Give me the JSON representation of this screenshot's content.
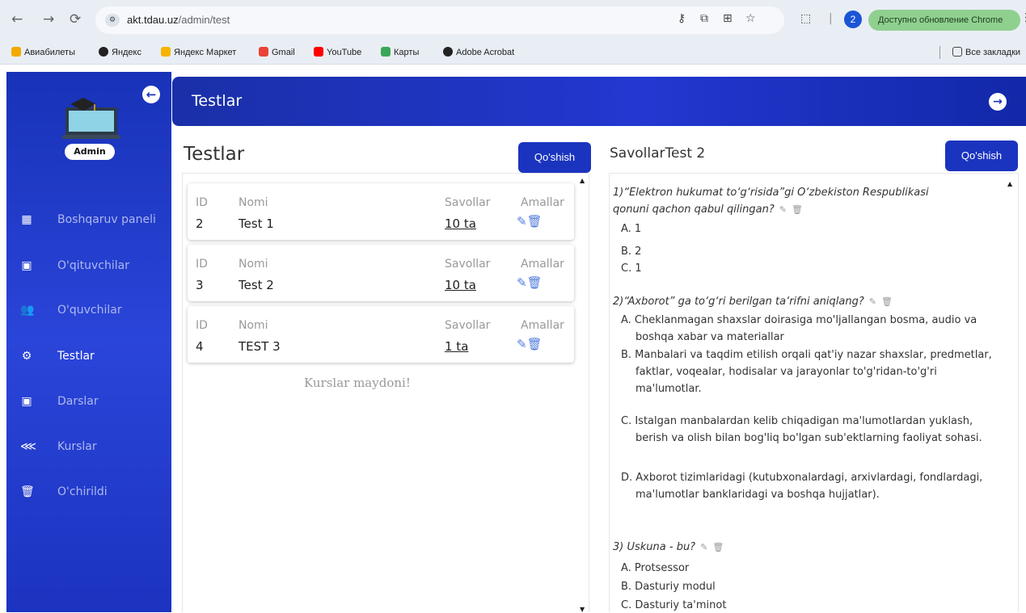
{
  "browser": {
    "url_host": "akt.tdau.uz",
    "url_path": "/admin/test",
    "profile_initial": "2",
    "update_text": "Доступно обновление Chrome",
    "bookmarks": [
      "Авиабилеты",
      "Яндекс",
      "Яндекс Маркет",
      "Gmail",
      "YouTube",
      "Карты",
      "Adobe Acrobat"
    ],
    "all_bookmarks": "Все закладки"
  },
  "sidebar": {
    "badge": "Admin",
    "items": [
      {
        "label": "Boshqaruv paneli",
        "icon": "dashboard-icon"
      },
      {
        "label": "O'qituvchilar",
        "icon": "teacher-icon"
      },
      {
        "label": "O'quvchilar",
        "icon": "students-icon"
      },
      {
        "label": "Testlar",
        "icon": "tests-icon"
      },
      {
        "label": "Darslar",
        "icon": "lessons-icon"
      },
      {
        "label": "Kurslar",
        "icon": "courses-icon"
      },
      {
        "label": "O'chirildi",
        "icon": "trash-icon"
      }
    ],
    "active": "Testlar"
  },
  "header": {
    "title": "Testlar"
  },
  "tests": {
    "title": "Testlar",
    "add_label": "Qo'shish",
    "headers": {
      "id": "ID",
      "name": "Nomi",
      "questions": "Savollar",
      "actions": "Amallar"
    },
    "rows": [
      {
        "id": "2",
        "name": "Test 1",
        "questions": "10 ta"
      },
      {
        "id": "3",
        "name": "Test 2",
        "questions": "10 ta"
      },
      {
        "id": "4",
        "name": "TEST 3",
        "questions": "1 ta"
      }
    ],
    "empty_note": "Kurslar maydoni!"
  },
  "questions": {
    "title": "SavollarTest 2",
    "add_label": "Qo'shish",
    "items": [
      {
        "text_line1": "1)“Elektron hukumat to‘g‘risida”gi O‘zbekiston Respublikasi",
        "text_line2": "qonuni qachon qabul qilingan?",
        "options": [
          "A. 1",
          "B. 2",
          "C. 1"
        ]
      },
      {
        "text_line1": "2)“Axborot” ga to‘g‘ri berilgan ta‘rifni aniqlang?",
        "options": [
          "A. Cheklanmagan shaxslar doirasiga mo'ljallangan bosma, audio va boshqa xabar va materiallar",
          "B. Manbalari va taqdim etilish orqali qat'iy nazar shaxslar, predmetlar, faktlar, voqealar, hodisalar va jarayonlar to'g'ridan-to'g'ri ma'lumotlar.",
          "C. Istalgan manbalardan kelib chiqadigan ma'lumotlardan yuklash, berish va olish bilan bog'liq bo'lgan sub'ektlarning faoliyat sohasi.",
          "D. Axborot tizimlaridagi (kutubxonalardagi, arxivlardagi, fondlardagi, ma'lumotlar banklaridagi va boshqa hujjatlar)."
        ]
      },
      {
        "text_line1": "3) Uskuna - bu?",
        "options": [
          "A. Protsessor",
          "B. Dasturiy modul",
          "C. Dasturiy ta'minot"
        ]
      }
    ]
  }
}
